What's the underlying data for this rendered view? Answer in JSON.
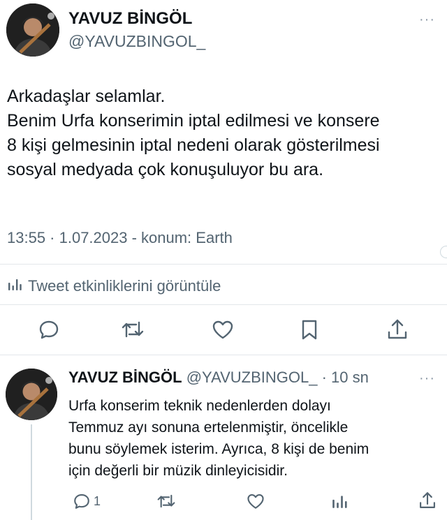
{
  "colors": {
    "text": "#0f1419",
    "secondary": "#536471",
    "divider": "#e3e7ea"
  },
  "main_tweet": {
    "display_name": "YAVUZ BİNGÖL",
    "handle": "@YAVUZBINGOL_",
    "more_icon": "more-horizontal-icon",
    "text_lines": [
      "Arkadaşlar selamlar.",
      "Benim Urfa konserimin iptal edilmesi ve konsere",
      "8 kişi gelmesinin iptal nedeni olarak gösterilmesi",
      "sosyal medyada çok konuşuluyor bu ara."
    ],
    "meta": "13:55 · 1.07.2023 - konum: Earth",
    "analytics_label": "Tweet etkinliklerini görüntüle",
    "actions": [
      "reply-icon",
      "retweet-icon",
      "like-icon",
      "bookmark-icon",
      "share-icon"
    ]
  },
  "reply_tweet": {
    "display_name": "YAVUZ BİNGÖL",
    "handle_time": "@YAVUZBINGOL_ · 10 sn",
    "text_lines": [
      "Urfa konserim teknik nedenlerden dolayı",
      "Temmuz ayı sonuna ertelenmiştir, öncelikle",
      "bunu söylemek isterim.  Ayrıca, 8 kişi de benim",
      "için değerli bir müzik dinleyicisidir."
    ],
    "reply_count": "1",
    "actions": [
      "reply-icon",
      "retweet-icon",
      "like-icon",
      "analytics-icon",
      "share-icon"
    ]
  }
}
